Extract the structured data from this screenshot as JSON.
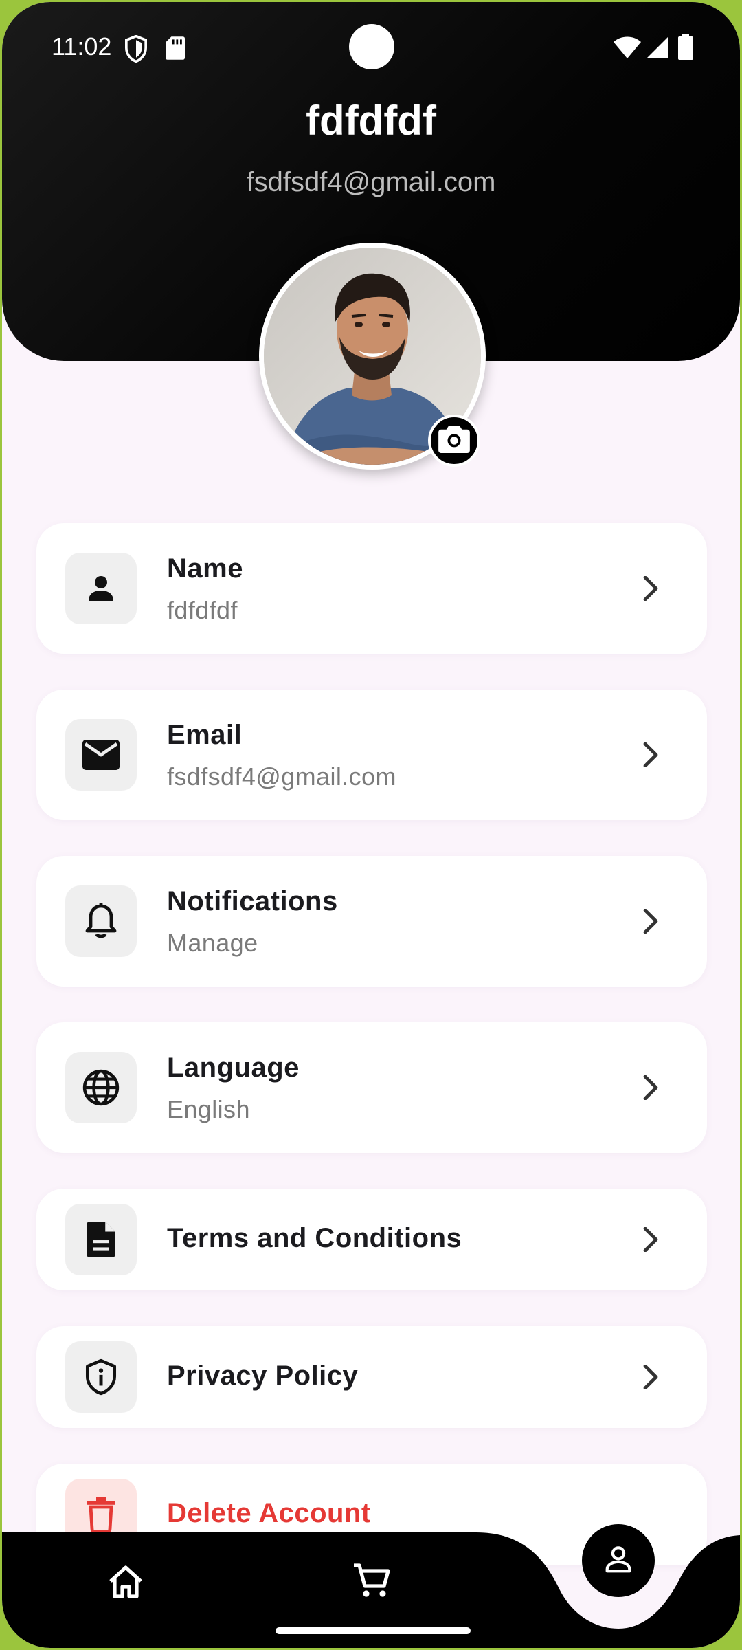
{
  "status_bar": {
    "time": "11:02",
    "icons": [
      "shield-icon",
      "sd-card-icon",
      "wifi-icon",
      "signal-icon",
      "battery-icon"
    ]
  },
  "profile": {
    "name": "fdfdfdf",
    "email": "fsdfsdf4@gmail.com",
    "avatar_alt": "profile-photo",
    "change_photo_icon": "camera-icon"
  },
  "settings": [
    {
      "key": "name",
      "title": "Name",
      "subtitle": "fdfdfdf",
      "icon": "person-icon"
    },
    {
      "key": "email",
      "title": "Email",
      "subtitle": "fsdfsdf4@gmail.com",
      "icon": "mail-icon"
    },
    {
      "key": "notifications",
      "title": "Notifications",
      "subtitle": "Manage",
      "icon": "bell-icon"
    },
    {
      "key": "language",
      "title": "Language",
      "subtitle": "English",
      "icon": "globe-icon"
    },
    {
      "key": "terms",
      "title": "Terms and Conditions",
      "icon": "document-icon"
    },
    {
      "key": "privacy",
      "title": "Privacy Policy",
      "icon": "shield-info-icon"
    },
    {
      "key": "delete",
      "title": "Delete Account",
      "icon": "trash-icon",
      "danger": true
    }
  ],
  "bottom_nav": {
    "items": [
      {
        "name": "home",
        "icon": "home-icon",
        "active": false
      },
      {
        "name": "cart",
        "icon": "cart-icon",
        "active": false
      },
      {
        "name": "profile",
        "icon": "person-outline-icon",
        "active": true
      }
    ]
  },
  "colors": {
    "header_bg": "#000000",
    "page_bg": "#fbf4fb",
    "card_bg": "#ffffff",
    "danger": "#e53935",
    "frame": "#9bc53d"
  }
}
